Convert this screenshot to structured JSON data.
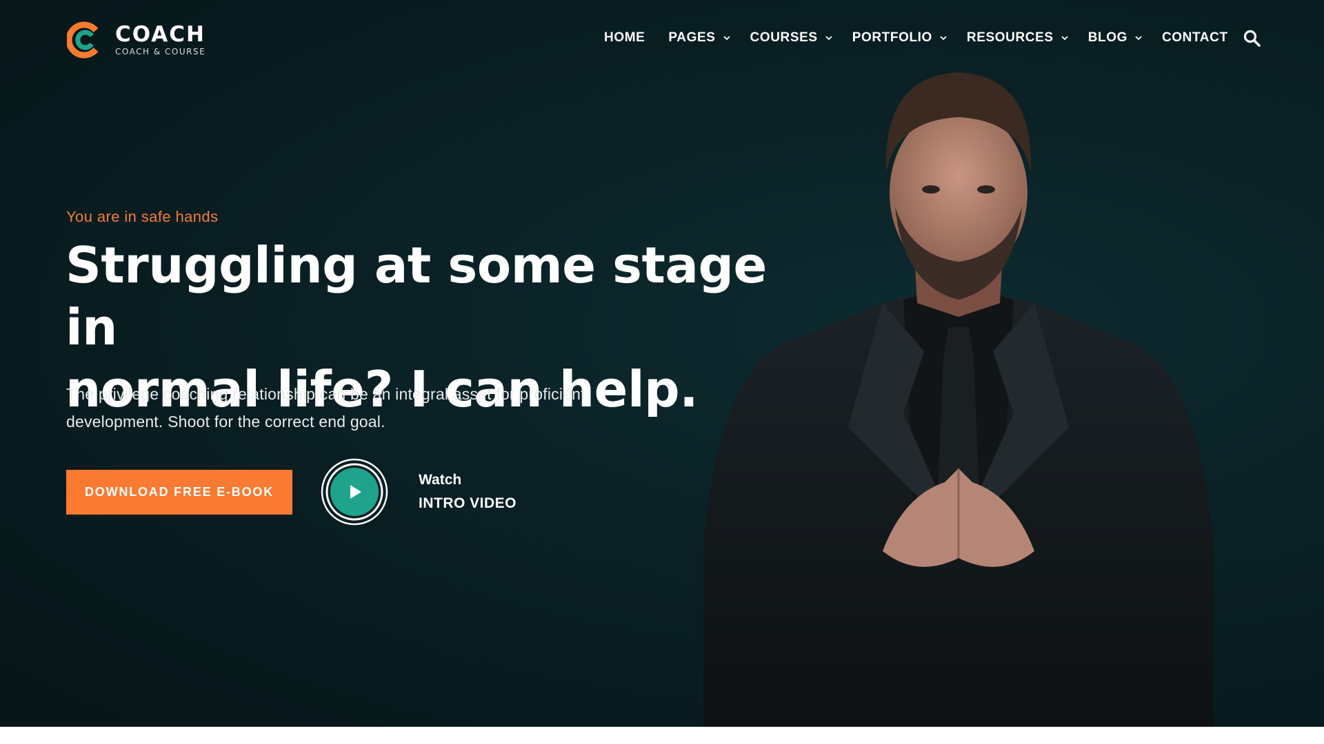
{
  "brand": {
    "name": "COACH",
    "tagline": "COACH & COURSE",
    "colors": {
      "accent": "#fa7a32",
      "teal": "#1fa38d",
      "background": "#0a2024"
    }
  },
  "nav": {
    "items": [
      {
        "label": "HOME",
        "has_dropdown": false
      },
      {
        "label": "PAGES",
        "has_dropdown": true
      },
      {
        "label": "COURSES",
        "has_dropdown": true
      },
      {
        "label": "PORTFOLIO",
        "has_dropdown": true
      },
      {
        "label": "RESOURCES",
        "has_dropdown": true
      },
      {
        "label": "BLOG",
        "has_dropdown": true
      },
      {
        "label": "CONTACT",
        "has_dropdown": false
      }
    ],
    "search_icon": "search-icon"
  },
  "hero": {
    "eyebrow": "You are in safe hands",
    "headline_line1": "Struggling at some stage in",
    "headline_line2": "normal life? I can help.",
    "subtext_line1": "The privilege coaching relationship can be an integral asset for proficient",
    "subtext_line2": "development. Shoot for the correct end goal.",
    "cta_label": "DOWNLOAD FREE E-BOOK",
    "video_label_1": "Watch",
    "video_label_2": "INTRO VIDEO",
    "play_icon": "play-icon"
  }
}
